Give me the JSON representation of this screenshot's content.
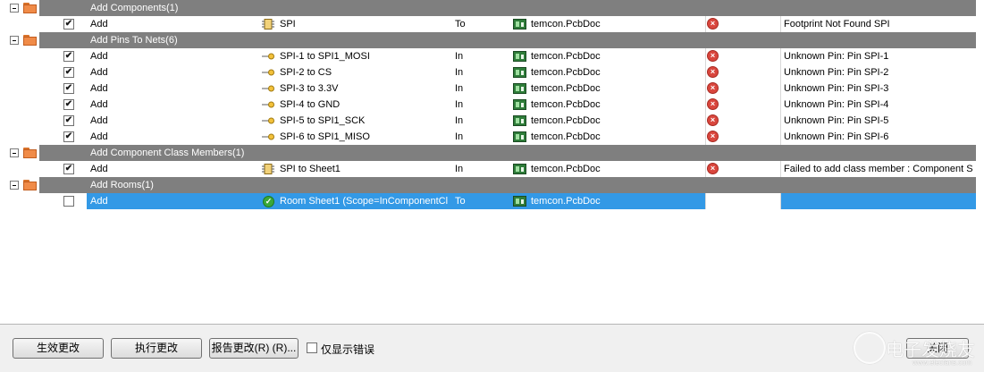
{
  "groups": [
    {
      "title": "Add Components(1)",
      "rows": [
        {
          "checked": true,
          "action": "Add",
          "icon": "component-icon",
          "affected": "SPI",
          "dir": "To",
          "doc": "temcon.PcbDoc",
          "status": "error",
          "msg": "Footprint Not Found SPI"
        }
      ]
    },
    {
      "title": "Add Pins To Nets(6)",
      "rows": [
        {
          "checked": true,
          "action": "Add",
          "icon": "pin-icon",
          "affected": "SPI-1 to SPI1_MOSI",
          "dir": "In",
          "doc": "temcon.PcbDoc",
          "status": "error",
          "msg": "Unknown Pin: Pin SPI-1"
        },
        {
          "checked": true,
          "action": "Add",
          "icon": "pin-icon",
          "affected": "SPI-2 to CS",
          "dir": "In",
          "doc": "temcon.PcbDoc",
          "status": "error",
          "msg": "Unknown Pin: Pin SPI-2"
        },
        {
          "checked": true,
          "action": "Add",
          "icon": "pin-icon",
          "affected": "SPI-3 to 3.3V",
          "dir": "In",
          "doc": "temcon.PcbDoc",
          "status": "error",
          "msg": "Unknown Pin: Pin SPI-3"
        },
        {
          "checked": true,
          "action": "Add",
          "icon": "pin-icon",
          "affected": "SPI-4 to GND",
          "dir": "In",
          "doc": "temcon.PcbDoc",
          "status": "error",
          "msg": "Unknown Pin: Pin SPI-4"
        },
        {
          "checked": true,
          "action": "Add",
          "icon": "pin-icon",
          "affected": "SPI-5 to SPI1_SCK",
          "dir": "In",
          "doc": "temcon.PcbDoc",
          "status": "error",
          "msg": "Unknown Pin: Pin SPI-5"
        },
        {
          "checked": true,
          "action": "Add",
          "icon": "pin-icon",
          "affected": "SPI-6 to SPI1_MISO",
          "dir": "In",
          "doc": "temcon.PcbDoc",
          "status": "error",
          "msg": "Unknown Pin: Pin SPI-6"
        }
      ]
    },
    {
      "title": "Add Component Class Members(1)",
      "rows": [
        {
          "checked": true,
          "action": "Add",
          "icon": "component-icon",
          "affected": "SPI to Sheet1",
          "dir": "In",
          "doc": "temcon.PcbDoc",
          "status": "error",
          "msg": "Failed to add class member : Component S"
        }
      ]
    },
    {
      "title": "Add Rooms(1)",
      "rows": [
        {
          "checked": false,
          "action": "Add",
          "icon": "room-ok-icon",
          "affected": "Room Sheet1 (Scope=InComponentCl",
          "dir": "To",
          "doc": "temcon.PcbDoc",
          "status": "none",
          "msg": "",
          "selected": true
        }
      ]
    }
  ],
  "footer": {
    "validate": "生效更改",
    "execute": "执行更改",
    "report": "报告更改(R) (R)...",
    "only_errors": "仅显示错误",
    "close": "关闭"
  },
  "watermark": {
    "text": "电子发烧友",
    "url": "www.elecfans.com"
  },
  "colors": {
    "group_band": "#7f7f7f",
    "selection": "#3399e6",
    "error": "#d9463d"
  }
}
